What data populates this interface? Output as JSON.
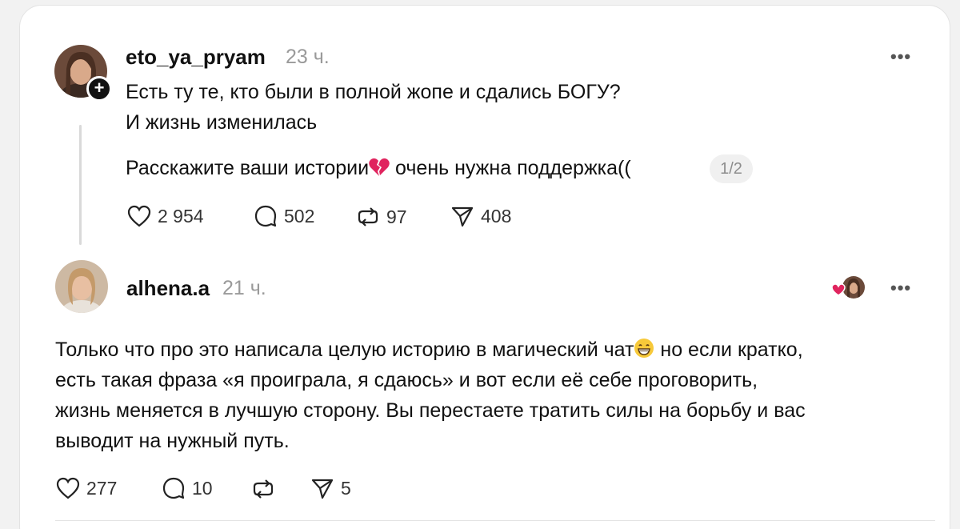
{
  "post1": {
    "username": "eto_ya_pryam",
    "time": "23 ч.",
    "more": "•••",
    "lines": [
      "Есть ту те, кто были в полной жопе и сдались БОГУ?",
      "И жизнь изменилась"
    ],
    "line3_before": "Расскажите ваши истории",
    "line3_emoji": "broken-heart-emoji",
    "line3_after": " очень нужна поддержка((",
    "pager": "1/2",
    "likes": "2 954",
    "comments": "502",
    "reposts": "97",
    "shares": "408"
  },
  "post2": {
    "username": "alhena.a",
    "time": "21 ч.",
    "more": "•••",
    "line1_before": "Только что про это написала целую историю в магический чат",
    "line1_emoji": "grinning-face-emoji",
    "line1_after": " но если кратко,",
    "lines": [
      "есть такая фраза «я проиграла, я сдаюсь» и вот если её себе проговорить,",
      "жизнь меняется в лучшую сторону. Вы перестаете тратить силы на борьбу и вас",
      "выводит на нужный путь."
    ],
    "likes": "277",
    "comments": "10",
    "shares": "5"
  },
  "colors": {
    "background": "#f2f2f2",
    "card": "#ffffff",
    "text": "#111111",
    "muted": "#9a9a9a",
    "heart_red": "#e0245e"
  }
}
